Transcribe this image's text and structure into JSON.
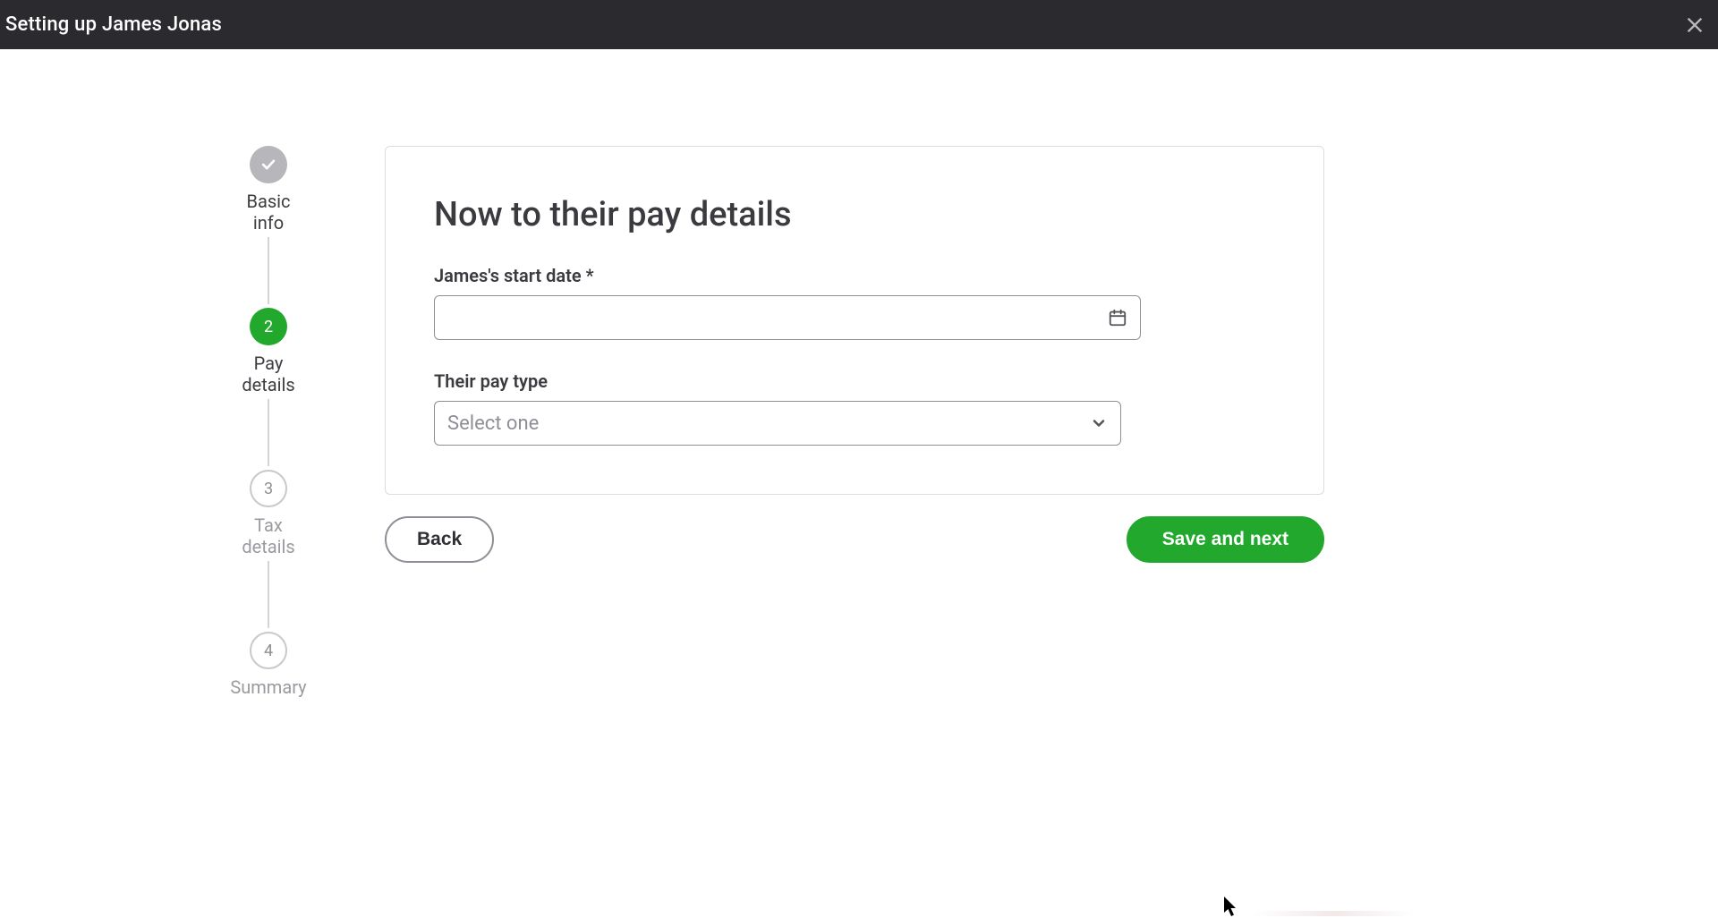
{
  "header": {
    "title": "Setting up James Jonas"
  },
  "stepper": {
    "steps": [
      {
        "label": "Basic\ninfo",
        "indicator": "✓",
        "state": "completed"
      },
      {
        "label": "Pay\ndetails",
        "indicator": "2",
        "state": "active"
      },
      {
        "label": "Tax\ndetails",
        "indicator": "3",
        "state": "pending"
      },
      {
        "label": "Summary",
        "indicator": "4",
        "state": "pending"
      }
    ]
  },
  "card": {
    "title": "Now to their pay details",
    "start_date": {
      "label": "James's start date *",
      "value": ""
    },
    "pay_type": {
      "label": "Their pay type",
      "placeholder": "Select one",
      "selected": ""
    }
  },
  "buttons": {
    "back": "Back",
    "next": "Save and next"
  }
}
